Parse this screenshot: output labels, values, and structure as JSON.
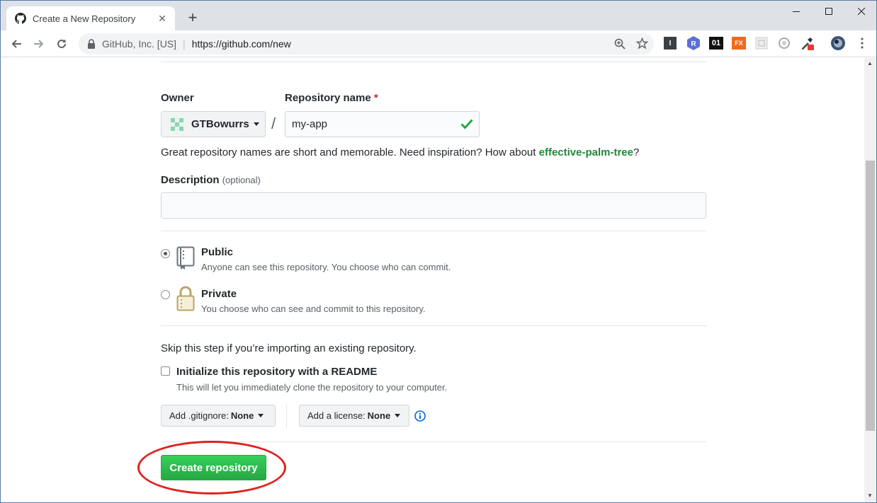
{
  "browser": {
    "tab_title": "Create a New Repository",
    "site_org": "GitHub, Inc. [US]",
    "url": "https://github.com/new",
    "extensions": [
      "I",
      "R",
      "01",
      "FX",
      "",
      "",
      ""
    ]
  },
  "form": {
    "owner_label": "Owner",
    "owner_value": "GTBowurrs",
    "repo_label": "Repository name",
    "required_mark": "*",
    "separator": "/",
    "repo_value": "my-app",
    "hint_text": "Great repository names are short and memorable. Need inspiration? How about ",
    "hint_suggestion": "effective-palm-tree",
    "hint_end": "?",
    "description_label": "Description",
    "description_optional": "(optional)",
    "description_value": "",
    "public_title": "Public",
    "public_note": "Anyone can see this repository. You choose who can commit.",
    "private_title": "Private",
    "private_note": "You choose who can see and commit to this repository.",
    "skip_text": "Skip this step if you’re importing an existing repository.",
    "readme_title": "Initialize this repository with a README",
    "readme_note": "This will let you immediately clone the repository to your computer.",
    "gitignore_label": "Add .gitignore:",
    "gitignore_value": "None",
    "license_label": "Add a license:",
    "license_value": "None",
    "create_button": "Create repository"
  },
  "state": {
    "visibility": "public",
    "readme_checked": false
  },
  "colors": {
    "primary_green": "#28a745",
    "suggestion_green": "#22863a",
    "required_red": "#cb2431",
    "annotation_red": "#e02020",
    "info_blue": "#0366d6"
  }
}
